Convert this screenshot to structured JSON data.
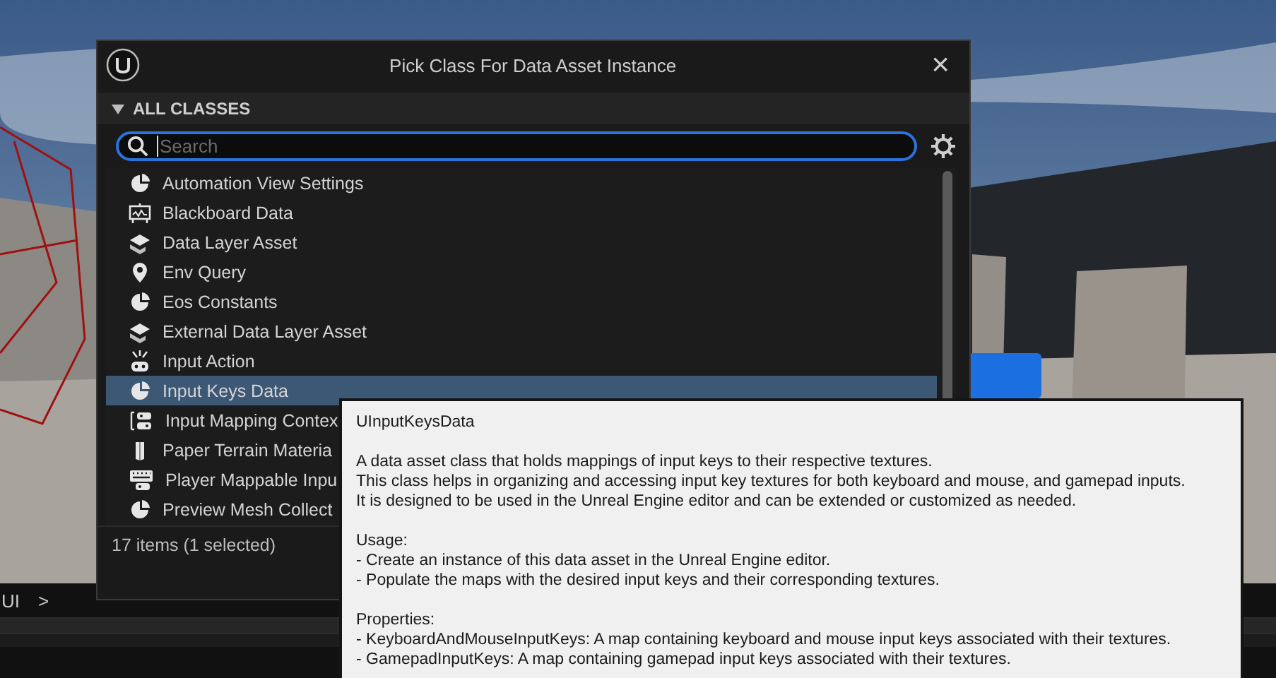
{
  "dialog": {
    "title": "Pick Class For Data Asset Instance",
    "close": "×",
    "section": {
      "label": "ALL CLASSES",
      "expanded": true
    },
    "search": {
      "placeholder": "Search"
    },
    "items": [
      {
        "label": "Automation View Settings",
        "kind": "pie",
        "selected": false
      },
      {
        "label": "Blackboard Data",
        "kind": "board",
        "selected": false
      },
      {
        "label": "Data Layer Asset",
        "kind": "layers",
        "selected": false
      },
      {
        "label": "Env Query",
        "kind": "pin",
        "selected": false
      },
      {
        "label": "Eos Constants",
        "kind": "pie",
        "selected": false
      },
      {
        "label": "External Data Layer Asset",
        "kind": "layers",
        "selected": false
      },
      {
        "label": "Input Action",
        "kind": "action",
        "selected": false
      },
      {
        "label": "Input Keys Data",
        "kind": "pie",
        "selected": true
      },
      {
        "label": "Input Mapping Contex",
        "kind": "mapping",
        "selected": false
      },
      {
        "label": "Paper Terrain Materia",
        "kind": "paper",
        "selected": false
      },
      {
        "label": "Player Mappable Inpu",
        "kind": "keyboard",
        "selected": false
      },
      {
        "label": "Preview Mesh Collect",
        "kind": "pie",
        "selected": false
      }
    ],
    "footer": "17 items (1 selected)"
  },
  "breadcrumb": {
    "label": "UI",
    "separator": ">"
  },
  "tooltip": {
    "title": "UInputKeysData",
    "paragraphs": [
      [
        "A data asset class that holds mappings of input keys to their respective textures.",
        "This class helps in organizing and accessing input key textures for both keyboard and mouse, and gamepad inputs.",
        "It is designed to be used in the Unreal Engine editor and can be extended or customized as needed."
      ],
      [
        "Usage:",
        "- Create an instance of this data asset in the Unreal Engine editor.",
        "- Populate the maps with the desired input keys and their corresponding textures."
      ],
      [
        "Properties:",
        "- KeyboardAndMouseInputKeys: A map containing keyboard and mouse input keys associated with their textures.",
        "- GamepadInputKeys: A map containing gamepad input keys associated with their textures."
      ]
    ]
  }
}
